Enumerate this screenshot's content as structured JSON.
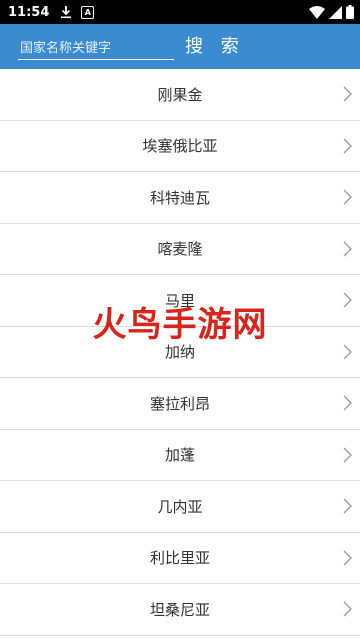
{
  "status_bar": {
    "time": "11:54"
  },
  "header": {
    "search_placeholder": "国家名称关键字",
    "search_button": "搜 索",
    "color": "#3a8bd0"
  },
  "countries": [
    "刚果金",
    "埃塞俄比亚",
    "科特迪瓦",
    "喀麦隆",
    "马里",
    "加纳",
    "塞拉利昂",
    "加蓬",
    "几内亚",
    "利比里亚",
    "坦桑尼亚"
  ],
  "watermark": "火鸟手游网"
}
